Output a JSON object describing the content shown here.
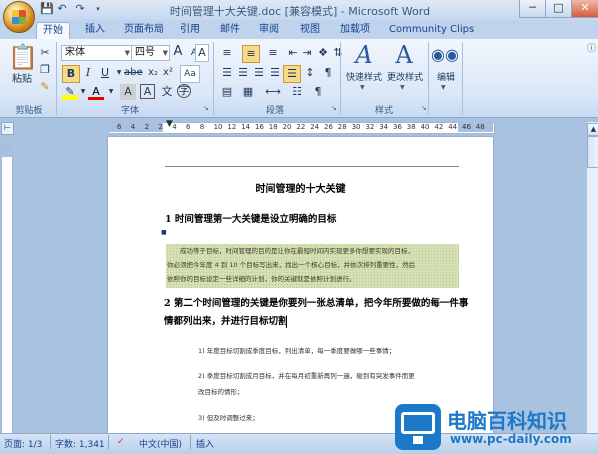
{
  "window": {
    "title": "时间管理十大关键.doc [兼容模式] - Microsoft Word",
    "qat_icons": [
      "save-icon",
      "undo-icon",
      "redo-icon"
    ],
    "controls": {
      "minimize": "─",
      "maximize": "□",
      "close": "✕"
    }
  },
  "tabs": [
    "开始",
    "插入",
    "页面布局",
    "引用",
    "邮件",
    "审阅",
    "视图",
    "加载项",
    "Community Clips"
  ],
  "active_tab": "开始",
  "ribbon": {
    "clipboard": {
      "label": "剪贴板",
      "paste_label": "粘贴"
    },
    "font": {
      "label": "字体",
      "font_name": "宋体",
      "font_size": "四号",
      "format_chars": [
        "A",
        "A"
      ]
    },
    "paragraph": {
      "label": "段落"
    },
    "styles": {
      "label": "样式",
      "quick_styles": "快速样式",
      "change_styles": "更改样式"
    },
    "editing": {
      "label": "编辑"
    }
  },
  "ruler": {
    "numbers": [
      "6",
      "4",
      "2",
      "2",
      "4",
      "6",
      "8",
      "10",
      "12",
      "14",
      "16",
      "18",
      "20",
      "22",
      "24",
      "26",
      "28",
      "30",
      "32",
      "34",
      "36",
      "38",
      "40",
      "42",
      "44",
      "46",
      "48"
    ]
  },
  "document": {
    "title": "时间管理的十大关键",
    "heading1": "1  时间管理第一大关键是设立明确的目标",
    "highlight_text": [
      "成功等于目标，时间管理的目的是让你在最短时间内实现更多你想要实现的目标，",
      "你必须把今年度 4 到 10 个目标写出来，找出一个核心目标，并依次排列重要性，然后",
      "依照你的目标设定一些详细的计划，你的关键就是依照计划进行。"
    ],
    "heading2_line1": "2  第二个时间管理的关键是你要列一张总清单，把今年所要做的每一件事",
    "heading2_line2": "情都列出来，并进行目标切割",
    "items": [
      "1) 年度目标切割成季度目标，列出清单，每一季度要做哪一些事情；",
      "2) 季度目标切割成月目标，并在每月初重新再列一遍，碰到有突发事件而更",
      "改目标的情形；",
      "3) 但及时调整过来；"
    ]
  },
  "status": {
    "page": "页面: 1/3",
    "words": "字数: 1,341",
    "language": "中文(中国)",
    "mode": "插入"
  },
  "watermark": {
    "brand": "电脑百科知识",
    "url": "www.pc-daily.com"
  }
}
